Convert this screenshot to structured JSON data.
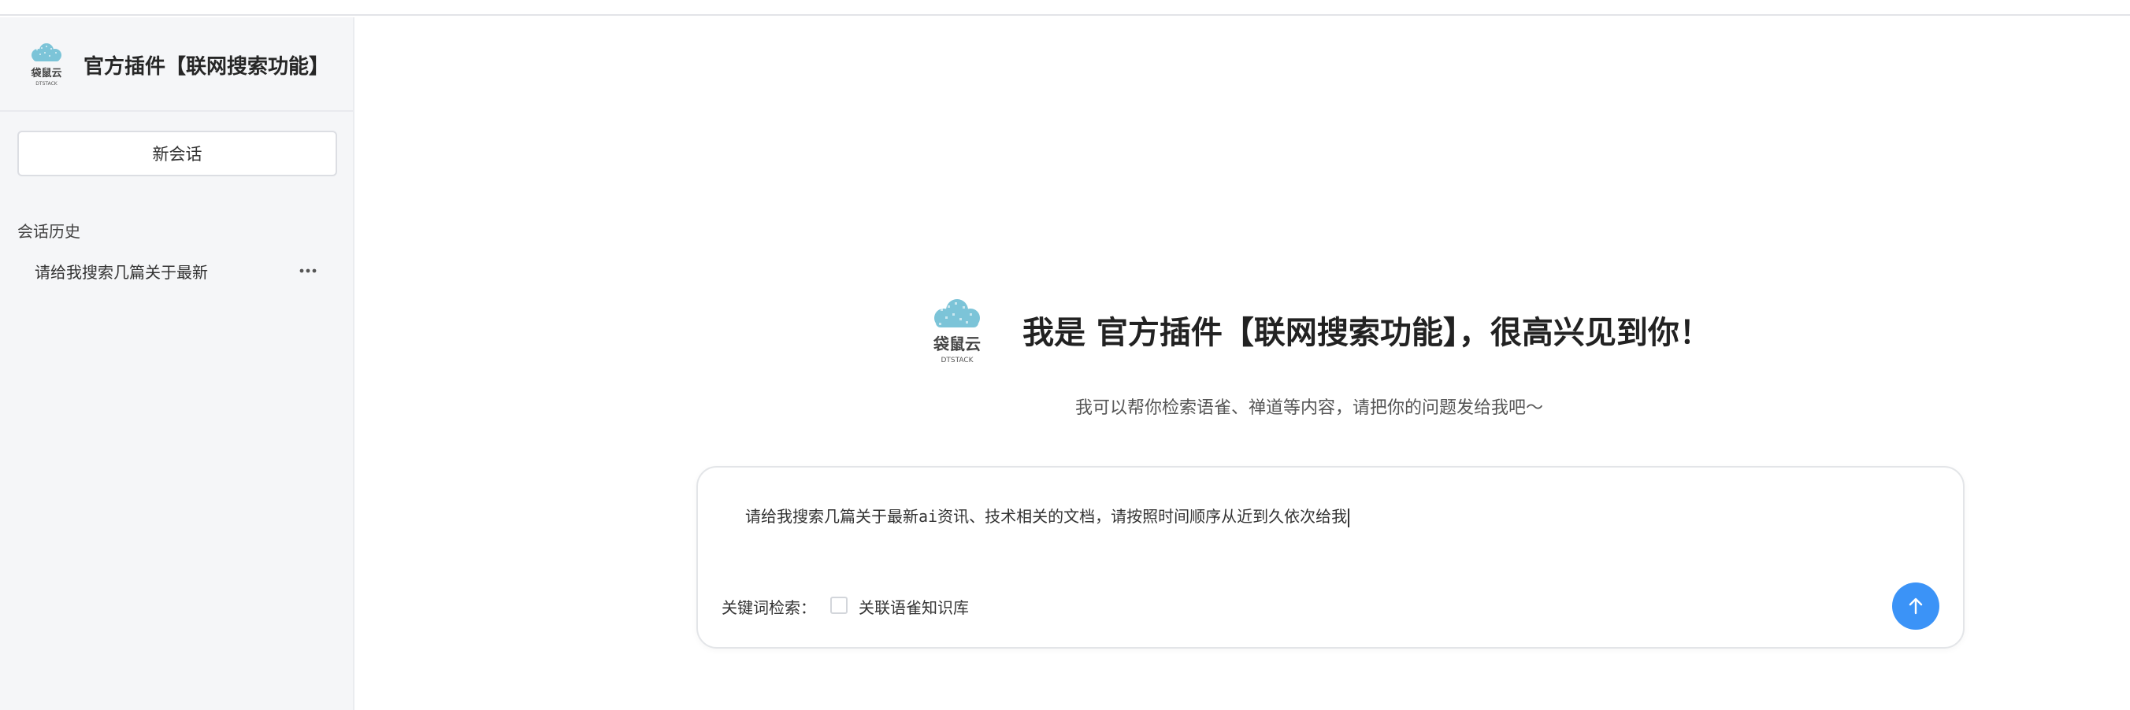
{
  "app": {
    "title": "官方插件【联网搜索功能】",
    "logo_icon": "ystack-cloud-logo",
    "accent_color": "#3b93f7"
  },
  "sidebar": {
    "new_chat_label": "新会话",
    "history_title": "会话历史",
    "history_items": [
      {
        "label": "请给我搜索几篇关于最新"
      }
    ]
  },
  "welcome": {
    "title": "我是 官方插件【联网搜索功能】，很高兴见到你！",
    "subtitle": "我可以帮你检索语雀、禅道等内容，请把你的问题发给我吧～"
  },
  "composer": {
    "input_value": "请给我搜索几篇关于最新ai资讯、技术相关的文档，请按照时间顺序从近到久依次给我",
    "keyword_label": "关键词检索：",
    "checkbox_label": "关联语雀知识库",
    "checkbox_checked": false,
    "send_icon": "arrow-up-icon"
  }
}
